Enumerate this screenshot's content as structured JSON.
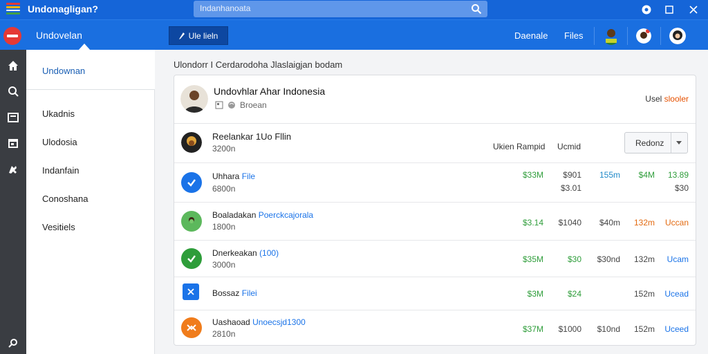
{
  "window": {
    "title": "Undonagligan?",
    "search_placeholder": "Indanhanoata",
    "flag_colors": [
      "#e53935",
      "#ffb300",
      "#ffffff",
      "#43a047"
    ]
  },
  "topbar": {
    "app_name": "Undovelan",
    "action_label": "Ule lieln",
    "links": [
      "Daenale",
      "Files"
    ]
  },
  "sidebar": {
    "selected": "Undownan",
    "items": [
      "Ukadnis",
      "Ulodosia",
      "Indanfain",
      "Conoshana",
      "Vesitiels"
    ]
  },
  "breadcrumb": "Ulondorr I Cerdarodoha Jlaslaigjan bodam",
  "card": {
    "title": "Undovhlar Ahar Indonesia",
    "subtitle": "Broean",
    "right_label": "Usel",
    "right_value": "slooler"
  },
  "list_header": {
    "name": "Reelankar 1Uo Fllin",
    "meta": "3200n",
    "col1": "Ukien Rampid",
    "col2": "Ucmid",
    "dropdown": "Redonz"
  },
  "rows": [
    {
      "name": "Uhhara",
      "highlight": "File",
      "meta": "6800n",
      "icon": "check-circle-icon",
      "v1": "$33M",
      "v2": "$901",
      "v2b": "$3.01",
      "v3": "155m",
      "v4": "$4M",
      "v5": "13.89",
      "v5b": "$30"
    },
    {
      "name": "Boaladakan",
      "highlight": "Poerckcajorala",
      "meta": "1800n",
      "icon": "person-icon",
      "v1": "$3.14",
      "v2": "$1040",
      "v3": "$40m",
      "v4": "132m",
      "v5": "Uccan"
    },
    {
      "name": "Dnerkeakan",
      "highlight": "(100)",
      "meta": "3000n",
      "icon": "check-circle-icon",
      "v1": "$35M",
      "v2": "$30",
      "v3": "$30nd",
      "v4": "132m",
      "v5": "Ucam"
    },
    {
      "name": "Bossaz",
      "highlight": "Filei",
      "meta": "",
      "icon": "close-square-icon",
      "v1": "$3M",
      "v2": "$24",
      "v3": "",
      "v4": "152m",
      "v5": "Ucead"
    },
    {
      "name": "Uashaoad",
      "highlight": "Unoecsjd1300",
      "meta": "2810n",
      "icon": "hub-icon",
      "v1": "$37M",
      "v2": "$1000",
      "v3": "$10nd",
      "v4": "152m",
      "v5": "Uceed"
    }
  ]
}
